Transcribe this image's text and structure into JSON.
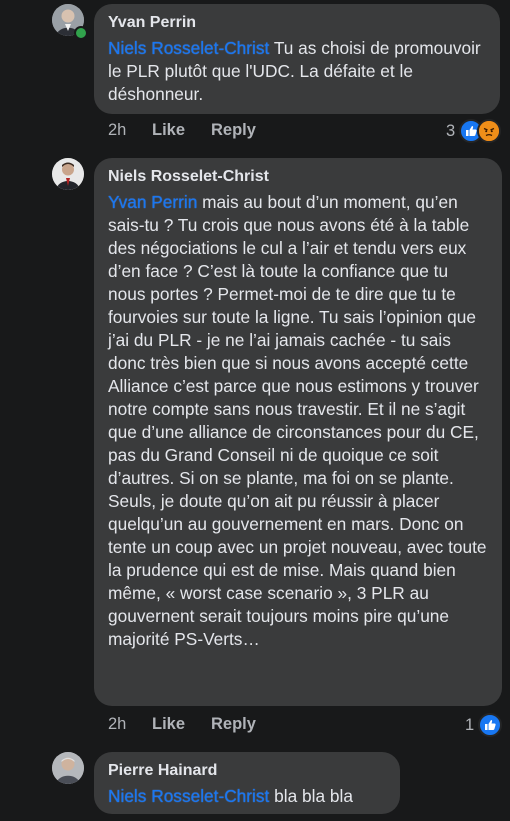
{
  "comments": [
    {
      "author": "Yvan Perrin",
      "mention": "Niels Rosselet-Christ",
      "text": " Tu as choisi de promouvoir le PLR plutôt que l'UDC. La défaite et le déshonneur.",
      "time": "2h",
      "like_label": "Like",
      "reply_label": "Reply",
      "reaction_count": "3",
      "reactions": [
        "like-icon",
        "angry-icon"
      ],
      "online": true
    },
    {
      "author": "Niels Rosselet-Christ",
      "mention": "Yvan Perrin",
      "text": " mais au bout d’un moment, qu’en sais-tu ? Tu crois que nous avons été à la table des négociations le cul a l’air et tendu vers eux d’en face ? C’est là toute la confiance que tu nous portes ? Permet-moi de te dire que tu te fourvoies sur toute la ligne. Tu sais l’opinion que j’ai du PLR - je ne l’ai jamais cachée - tu sais donc très bien que si nous avons accepté cette Alliance c’est parce que nous estimons y trouver notre compte sans nous travestir. Et il ne s’agit que d’une alliance de circonstances pour du CE, pas du Grand Conseil ni de quoique ce soit d’autres. Si on se plante, ma foi on se plante. Seuls, je doute qu’on ait pu réussir à placer quelqu’un au gouvernement en mars. Donc on tente un coup avec un projet nouveau, avec toute la prudence qui est de mise. Mais quand bien même, « worst case scenario », 3 PLR au gouvernent serait toujours moins pire qu’une majorité PS-Verts…",
      "time": "2h",
      "like_label": "Like",
      "reply_label": "Reply",
      "reaction_count": "1",
      "reactions": [
        "like-icon"
      ],
      "online": false
    },
    {
      "author": "Pierre Hainard",
      "mention": "Niels Rosselet-Christ",
      "text": " bla bla bla",
      "online": false
    }
  ],
  "colors": {
    "background": "#18191a",
    "bubble": "#3a3b3c",
    "mention": "#1877f2",
    "secondary_text": "#b0b3b8",
    "like": "#1877f2",
    "angry": "#e9710f",
    "online": "#31a24c"
  }
}
